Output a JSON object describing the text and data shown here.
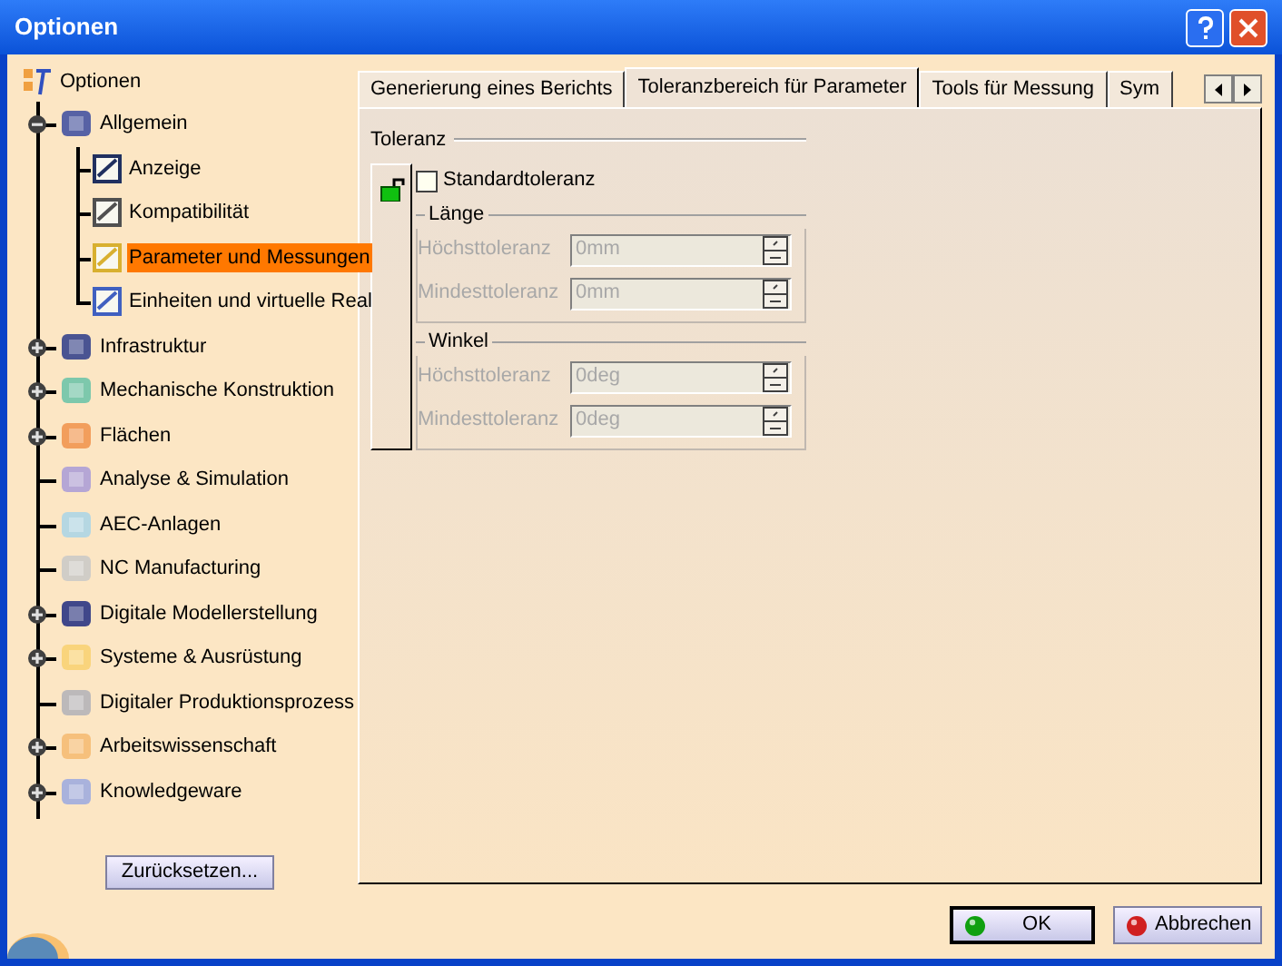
{
  "window": {
    "title": "Optionen"
  },
  "tree": {
    "label": "Optionen",
    "children": [
      {
        "label": "Allgemein",
        "kind": "branch",
        "expanded": true,
        "selected": false,
        "children": [
          {
            "label": "Anzeige",
            "selected": false
          },
          {
            "label": "Kompatibilität",
            "selected": false
          },
          {
            "label": "Parameter und Messungen",
            "selected": true
          },
          {
            "label": "Einheiten und virtuelle Real",
            "selected": false
          }
        ]
      },
      {
        "label": "Infrastruktur",
        "kind": "branch",
        "expanded": false,
        "selected": false
      },
      {
        "label": "Mechanische Konstruktion",
        "kind": "branch",
        "expanded": false,
        "selected": false
      },
      {
        "label": "Flächen",
        "kind": "branch",
        "expanded": false,
        "selected": false
      },
      {
        "label": "Analyse & Simulation",
        "kind": "leaf",
        "selected": false
      },
      {
        "label": "AEC-Anlagen",
        "kind": "leaf",
        "selected": false
      },
      {
        "label": "NC Manufacturing",
        "kind": "leaf",
        "selected": false
      },
      {
        "label": "Digitale Modellerstellung",
        "kind": "branch",
        "expanded": false,
        "selected": false
      },
      {
        "label": "Systeme & Ausrüstung",
        "kind": "branch",
        "expanded": false,
        "selected": false
      },
      {
        "label": "Digitaler Produktionsprozess",
        "kind": "leaf",
        "selected": false
      },
      {
        "label": "Arbeitswissenschaft",
        "kind": "branch",
        "expanded": false,
        "selected": false
      },
      {
        "label": "Knowledgeware",
        "kind": "branch",
        "expanded": false,
        "selected": false
      }
    ]
  },
  "reset_button": "Zurücksetzen...",
  "tabs": [
    {
      "label": "Generierung eines Berichts",
      "selected": false
    },
    {
      "label": "Toleranzbereich für Parameter",
      "selected": true
    },
    {
      "label": "Tools für Messung",
      "selected": false
    },
    {
      "label": "Sym",
      "selected": false
    }
  ],
  "tolerance": {
    "title": "Toleranz",
    "checkbox": {
      "label": "Standardtoleranz",
      "checked": false
    },
    "groups": [
      {
        "title": "Länge",
        "fields": [
          {
            "label": "Höchsttoleranz",
            "value": "0mm",
            "disabled": true
          },
          {
            "label": "Mindesttoleranz",
            "value": "0mm",
            "disabled": true
          }
        ]
      },
      {
        "title": "Winkel",
        "fields": [
          {
            "label": "Höchsttoleranz",
            "value": "0deg",
            "disabled": true
          },
          {
            "label": "Mindesttoleranz",
            "value": "0deg",
            "disabled": true
          }
        ]
      }
    ]
  },
  "buttons": [
    {
      "label": "OK",
      "kind": "ok"
    },
    {
      "label": "Abbrechen",
      "kind": "cancel"
    }
  ]
}
